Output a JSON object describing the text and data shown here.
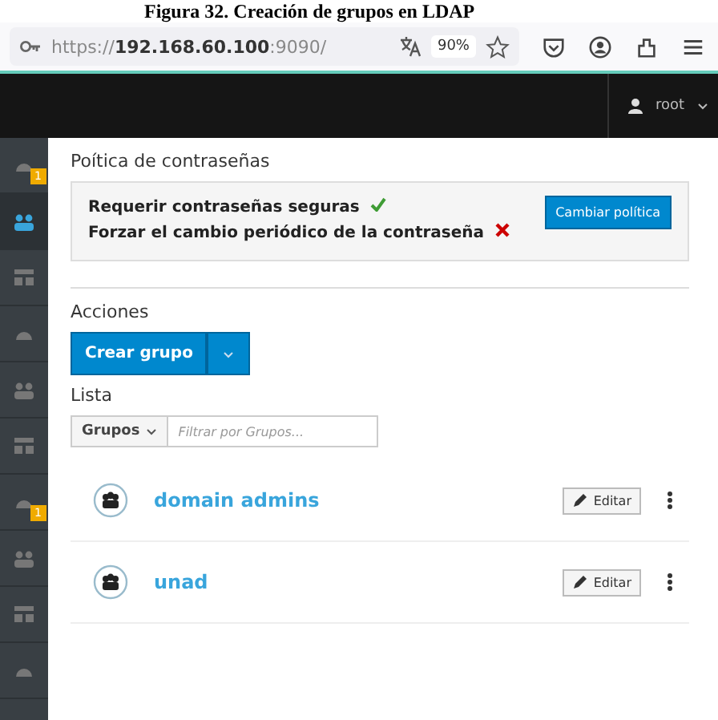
{
  "caption": "Figura 32. Creación de grupos en LDAP",
  "browser": {
    "url": "https://**192.168.60.100**:9090/",
    "zoom": "90%"
  },
  "header": {
    "user": "root"
  },
  "sidebar": {
    "items": [
      {
        "selected": false,
        "badge": "1"
      },
      {
        "selected": true
      },
      {
        "selected": false
      },
      {
        "selected": false
      },
      {
        "selected": false
      },
      {
        "selected": false
      },
      {
        "selected": false,
        "badge": "1"
      },
      {
        "selected": false
      },
      {
        "selected": false
      },
      {
        "selected": false
      }
    ]
  },
  "policy": {
    "title": "Poítica de contraseñas",
    "rules": [
      {
        "label": "Requerir contraseñas seguras",
        "enabled": true
      },
      {
        "label": "Forzar el cambio periódico de la contraseña",
        "enabled": false
      }
    ],
    "button": "Cambiar política"
  },
  "actions": {
    "title": "Acciones",
    "button": "Crear grupo"
  },
  "list": {
    "title": "Lista",
    "filter_type": "Grupos",
    "placeholder": "Filtrar por Grupos...",
    "groups": [
      {
        "name": "domain admins",
        "edit": "Editar"
      },
      {
        "name": "unad",
        "edit": "Editar"
      }
    ]
  }
}
